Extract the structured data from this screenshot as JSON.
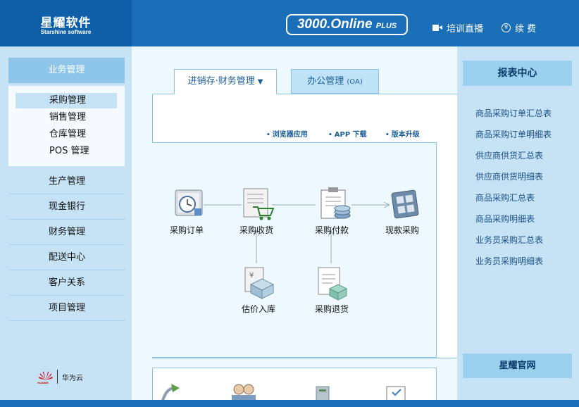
{
  "header": {
    "logo_title": "星耀软件",
    "logo_subtitle": "Starshine software",
    "version_main": "3000.Online",
    "version_plus": "PLUS",
    "live_training": "培训直播",
    "renew": "续 费"
  },
  "sidebar": {
    "business_header": "业务管理",
    "sub_items": [
      "采购管理",
      "销售管理",
      "仓库管理",
      "POS 管理"
    ],
    "items": [
      "生产管理",
      "现金银行",
      "财务管理",
      "配送中心",
      "客户关系",
      "项目管理"
    ],
    "partner_brand": "华为云",
    "partner_logo_text": "HUAWEI"
  },
  "main": {
    "tab_active": "进销存·财务管理",
    "tab_active_arrow": "▼",
    "tab_oa": "办公管理",
    "tab_oa_suffix": "(OA)",
    "links": [
      "浏览器应用",
      "APP 下载",
      "版本升级"
    ],
    "flow": {
      "purchase_order": "采购订单",
      "purchase_receipt": "采购收货",
      "purchase_payment": "采购付款",
      "cash_purchase": "现款采购",
      "estimate_inbound": "估价入库",
      "purchase_return": "采购退货"
    }
  },
  "right": {
    "report_header": "报表中心",
    "reports": [
      "商品采购订单汇总表",
      "商品采购订单明细表",
      "供应商供货汇总表",
      "供应商供货明细表",
      "商品采购汇总表",
      "商品采购明细表",
      "业务员采购汇总表",
      "业务员采购明细表"
    ],
    "official_site": "星耀官网"
  },
  "colors": {
    "header_blue": "#1a6fb8",
    "sidebar_blue": "#c6e3f5",
    "accent_blue": "#1a5d97"
  }
}
